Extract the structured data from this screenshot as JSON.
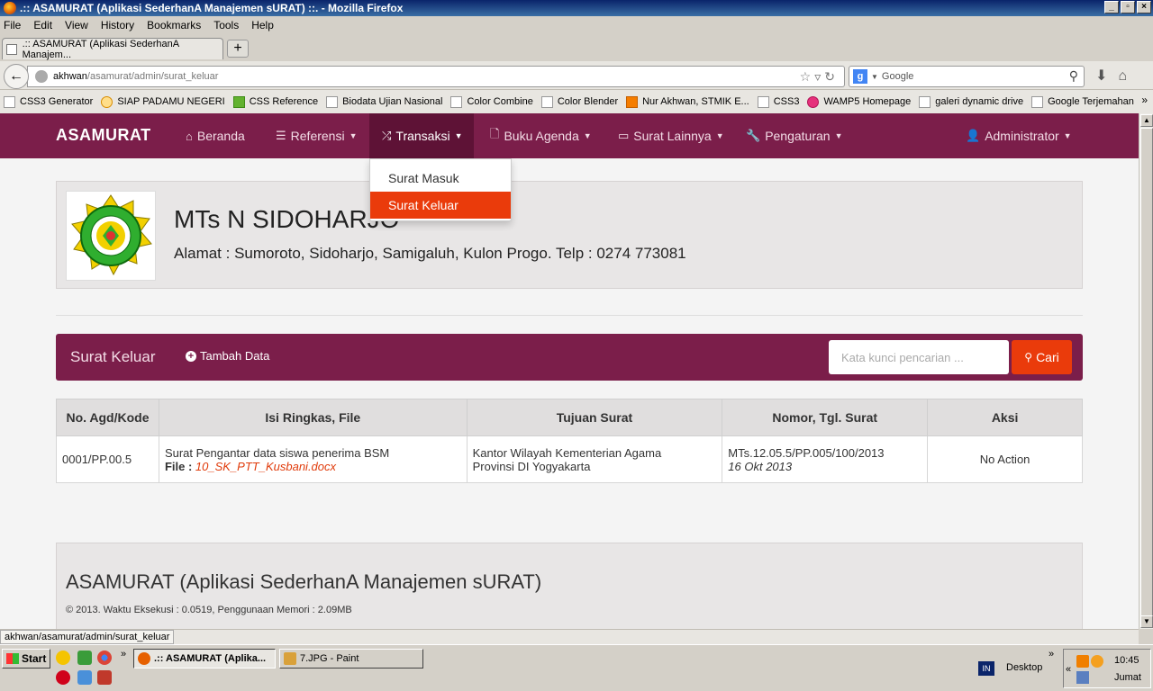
{
  "window": {
    "title": ".:: ASAMURAT (Aplikasi SederhanA Manajemen sURAT) ::. - Mozilla Firefox",
    "controls": [
      "_",
      "▫",
      "×"
    ]
  },
  "menu": [
    "File",
    "Edit",
    "View",
    "History",
    "Bookmarks",
    "Tools",
    "Help"
  ],
  "tab": {
    "label": ".:: ASAMURAT (Aplikasi SederhanA Manajem...",
    "new_tab": "+"
  },
  "address": {
    "host": "akhwan",
    "path": "/asamurat/admin/surat_keluar"
  },
  "search_box": {
    "engine": "g",
    "placeholder": "Google"
  },
  "bookmarks": [
    {
      "label": "CSS3 Generator",
      "icon": "page-icon"
    },
    {
      "label": "SIAP PADAMU NEGERI",
      "icon": "siap-icon"
    },
    {
      "label": "CSS Reference",
      "icon": "css-icon"
    },
    {
      "label": "Biodata Ujian Nasional",
      "icon": "page-icon"
    },
    {
      "label": "Color Combine",
      "icon": "page-icon"
    },
    {
      "label": "Color Blender",
      "icon": "page-icon"
    },
    {
      "label": "Nur Akhwan, STMIK E...",
      "icon": "blogger-icon"
    },
    {
      "label": "CSS3",
      "icon": "page-icon"
    },
    {
      "label": "WAMP5 Homepage",
      "icon": "wamp-icon"
    },
    {
      "label": "galeri dynamic drive",
      "icon": "page-icon"
    },
    {
      "label": "Google Terjemahan",
      "icon": "page-icon"
    }
  ],
  "site": {
    "brand": "ASAMURAT",
    "nav": [
      {
        "label": "Beranda",
        "icon": "⌂"
      },
      {
        "label": "Referensi",
        "icon": "☰"
      },
      {
        "label": "Transaksi",
        "icon": "⤮"
      },
      {
        "label": "Buku Agenda",
        "icon": "🗋"
      },
      {
        "label": "Surat Lainnya",
        "icon": "▭"
      },
      {
        "label": "Pengaturan",
        "icon": "🔧"
      },
      {
        "label": "Administrator",
        "icon": "👤"
      }
    ],
    "dropdown": [
      "Surat Masuk",
      "Surat Keluar"
    ],
    "colors": {
      "primary": "#7b1e4a",
      "accent": "#ea3b0b"
    }
  },
  "school": {
    "name": "MTs N SIDOHARJO",
    "address": "Alamat : Sumoroto, Sidoharjo, Samigaluh, Kulon Progo. Telp : 0274 773081"
  },
  "panel": {
    "title": "Surat Keluar",
    "add_label": "Tambah Data",
    "search_placeholder": "Kata kunci pencarian ...",
    "search_button": "Cari"
  },
  "table": {
    "headers": [
      "No. Agd/Kode",
      "Isi Ringkas, File",
      "Tujuan Surat",
      "Nomor, Tgl. Surat",
      "Aksi"
    ],
    "rows": [
      {
        "kode": "0001/PP.00.5",
        "isi": "Surat Pengantar data siswa penerima BSM",
        "file_label": "File :",
        "file": "10_SK_PTT_Kusbani.docx",
        "tujuan_1": "Kantor Wilayah Kementerian Agama",
        "tujuan_2": "Provinsi DI Yogyakarta",
        "nomor": "MTs.12.05.5/PP.005/100/2013",
        "tanggal": "16 Okt 2013",
        "aksi": "No Action"
      }
    ]
  },
  "footer": {
    "title": "ASAMURAT (Aplikasi SederhanA Manajemen sURAT)",
    "meta": "© 2013. Waktu Eksekusi : 0.0519, Penggunaan Memori : 2.09MB"
  },
  "status_url": "akhwan/asamurat/admin/surat_keluar",
  "taskbar": {
    "start": "Start",
    "tasks": [
      ".:: ASAMURAT (Aplika...",
      "7.JPG - Paint"
    ],
    "lang": "IN",
    "desktop": "Desktop",
    "time": "10:45",
    "day": "Jumat"
  }
}
